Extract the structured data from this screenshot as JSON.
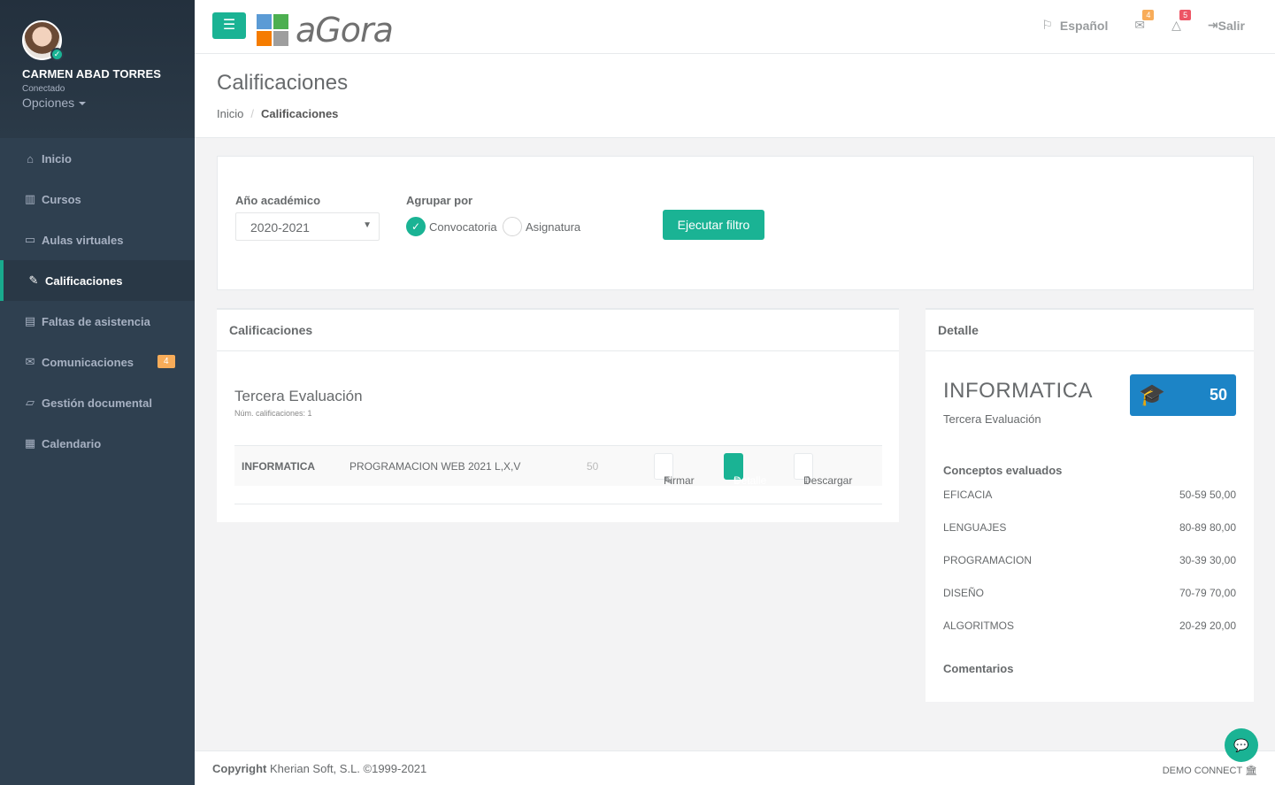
{
  "user": {
    "name": "CARMEN ABAD TORRES",
    "status": "Conectado",
    "options": "Opciones"
  },
  "nav": [
    {
      "label": "Inicio",
      "icon": "home-icon"
    },
    {
      "label": "Cursos",
      "icon": "books-icon"
    },
    {
      "label": "Aulas virtuales",
      "icon": "laptop-icon"
    },
    {
      "label": "Calificaciones",
      "icon": "graduation-icon",
      "active": true
    },
    {
      "label": "Faltas de asistencia",
      "icon": "clipboard-icon"
    },
    {
      "label": "Comunicaciones",
      "icon": "envelope-icon",
      "badge": "4"
    },
    {
      "label": "Gestión documental",
      "icon": "folder-icon"
    },
    {
      "label": "Calendario",
      "icon": "calendar-icon"
    }
  ],
  "topbar": {
    "menu_icon": "☰",
    "logo": "aGora",
    "language": "Español",
    "mail_count": "4",
    "alert_count": "5",
    "logout": "Salir"
  },
  "heading": {
    "title": "Calificaciones",
    "crumb_home": "Inicio",
    "crumb_sep": "/",
    "crumb_current": "Calificaciones"
  },
  "filter": {
    "year_label": "Año académico",
    "year_value": "2020-2021",
    "group_label": "Agrupar por",
    "option_1": "Convocatoria",
    "option_2": "Asignatura",
    "run": "Ejecutar filtro"
  },
  "grades": {
    "panel_title": "Calificaciones",
    "evaluation": "Tercera Evaluación",
    "count_text": "Núm. calificaciones: 1",
    "row": {
      "subject": "INFORMATICA",
      "course": "PROGRAMACION WEB 2021 L,X,V",
      "score": "50",
      "sign": "Firmar",
      "detail": "Detalle",
      "download": "Descargar"
    }
  },
  "detail": {
    "panel_title": "Detalle",
    "subject": "INFORMATICA",
    "evaluation": "Tercera Evaluación",
    "score": "50",
    "concepts_title": "Conceptos evaluados",
    "concepts": [
      {
        "name": "EFICACIA",
        "grade": "50-59 50,00"
      },
      {
        "name": "LENGUAJES",
        "grade": "80-89 80,00"
      },
      {
        "name": "PROGRAMACION",
        "grade": "30-39 30,00"
      },
      {
        "name": "DISEÑO",
        "grade": "70-79 70,00"
      },
      {
        "name": "ALGORITMOS",
        "grade": "20-29 20,00"
      }
    ],
    "comments_title": "Comentarios"
  },
  "footer": {
    "copyright_bold": "Copyright",
    "copyright_text": "Kherian Soft, S.L. ©1999-2021",
    "brand": "DEMO CONNECT"
  },
  "colors": {
    "sidebar": "#2f4050",
    "accent": "#1ab394",
    "score_box": "#1c84c6",
    "badge_warning": "#f8ac59",
    "badge_danger": "#ed5565"
  }
}
